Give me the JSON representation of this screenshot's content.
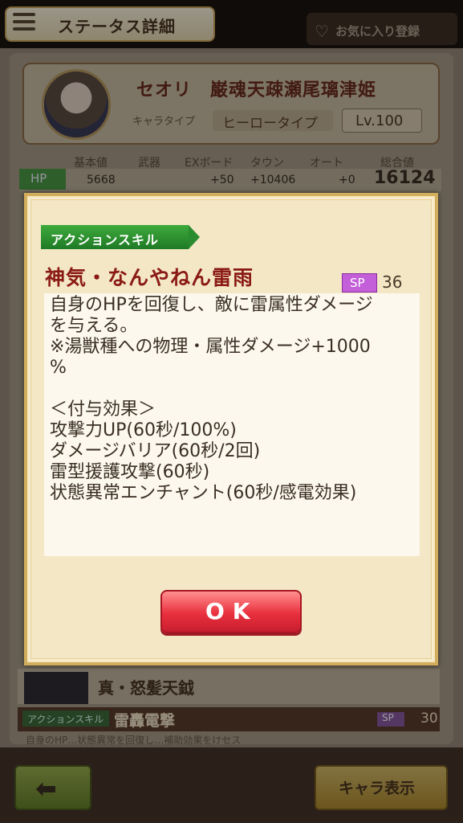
{
  "header": {
    "title": "ステータス詳細",
    "favorite_label": "お気に入り登録"
  },
  "character": {
    "name": "セオリ　巌魂天疎瀬尾璃津姫",
    "type_label": "キャラタイプ",
    "type_value": "ヒーロータイプ",
    "level": "Lv.100"
  },
  "stats": {
    "headers": [
      "基本値",
      "武器",
      "EXボード",
      "タウン",
      "オート",
      "総合値"
    ],
    "hp_label": "HP",
    "hp_values": [
      "5668",
      "",
      "+50",
      "+10406",
      "+0"
    ],
    "hp_total": "16124"
  },
  "ultimate": {
    "name": "真・怒髪天鉞"
  },
  "skill2": {
    "tag": "アクションスキル",
    "name": "雷轟電撃",
    "sp_label": "SP",
    "sp_cost": "30",
    "desc": "自身のHP…状態異常を回復し…補助効果をけセス"
  },
  "footer": {
    "view_label": "キャラ表示"
  },
  "dialog": {
    "tag": "アクションスキル",
    "skill_name": "神気・なんやねん雷雨",
    "sp_label": "SP",
    "sp_cost": "36",
    "description": "自身のHPを回復し、敵に雷属性ダメージ\nを与える。\n※湯獣種への物理・属性ダメージ+1000\n%\n\n＜付与効果＞\n攻撃力UP(60秒/100%)\nダメージバリア(60秒/2回)\n雷型援護攻撃(60秒)\n状態異常エンチャント(60秒/感電効果)",
    "ok_label": "OK"
  },
  "colors": {
    "accent_red": "#e9303e",
    "tag_green": "#2a8c2f",
    "sp_purple": "#c35fd8",
    "title_red": "#8a1a14"
  }
}
